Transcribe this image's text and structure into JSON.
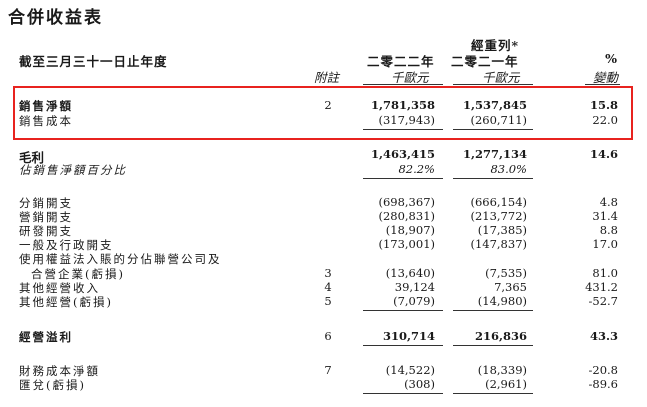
{
  "title": "合併收益表",
  "header": {
    "year_label": "截至三月三十一日止年度",
    "note_label": "附註",
    "col1_year": "二零二二年",
    "col1_unit": "千歐元",
    "col2_restated": "經重列*",
    "col2_year": "二零二一年",
    "col2_unit": "千歐元",
    "col3_symbol": "%",
    "col3_label": "變動"
  },
  "rows": [
    {
      "label": "銷售淨額",
      "note": "2",
      "v2022": "1,781,358",
      "v2021": "1,537,845",
      "change": "15.8"
    },
    {
      "label": "銷售成本",
      "note": "",
      "v2022": "(317,943)",
      "v2021": "(260,711)",
      "change": "22.0"
    },
    {
      "label": "毛利",
      "note": "",
      "v2022": "1,463,415",
      "v2021": "1,277,134",
      "change": "14.6"
    },
    {
      "label": "佔銷售淨額百分比",
      "note": "",
      "v2022": "82.2%",
      "v2021": "83.0%",
      "change": ""
    },
    {
      "label": "分銷開支",
      "note": "",
      "v2022": "(698,367)",
      "v2021": "(666,154)",
      "change": "4.8"
    },
    {
      "label": "營銷開支",
      "note": "",
      "v2022": "(280,831)",
      "v2021": "(213,772)",
      "change": "31.4"
    },
    {
      "label": "研發開支",
      "note": "",
      "v2022": "(18,907)",
      "v2021": "(17,385)",
      "change": "8.8"
    },
    {
      "label": "一般及行政開支",
      "note": "",
      "v2022": "(173,001)",
      "v2021": "(147,837)",
      "change": "17.0"
    },
    {
      "label": "使用權益法入賬的分佔聯營公司及",
      "note": "",
      "v2022": "",
      "v2021": "",
      "change": ""
    },
    {
      "label": "合營企業(虧損)",
      "note": "3",
      "v2022": "(13,640)",
      "v2021": "(7,535)",
      "change": "81.0"
    },
    {
      "label": "其他經營收入",
      "note": "4",
      "v2022": "39,124",
      "v2021": "7,365",
      "change": "431.2"
    },
    {
      "label": "其他經營(虧損)",
      "note": "5",
      "v2022": "(7,079)",
      "v2021": "(14,980)",
      "change": "-52.7"
    },
    {
      "label": "經營溢利",
      "note": "6",
      "v2022": "310,714",
      "v2021": "216,836",
      "change": "43.3"
    },
    {
      "label": "財務成本淨額",
      "note": "7",
      "v2022": "(14,522)",
      "v2021": "(18,339)",
      "change": "-20.8"
    },
    {
      "label": "匯兌(虧損)",
      "note": "",
      "v2022": "(308)",
      "v2021": "(2,961)",
      "change": "-89.6"
    }
  ]
}
